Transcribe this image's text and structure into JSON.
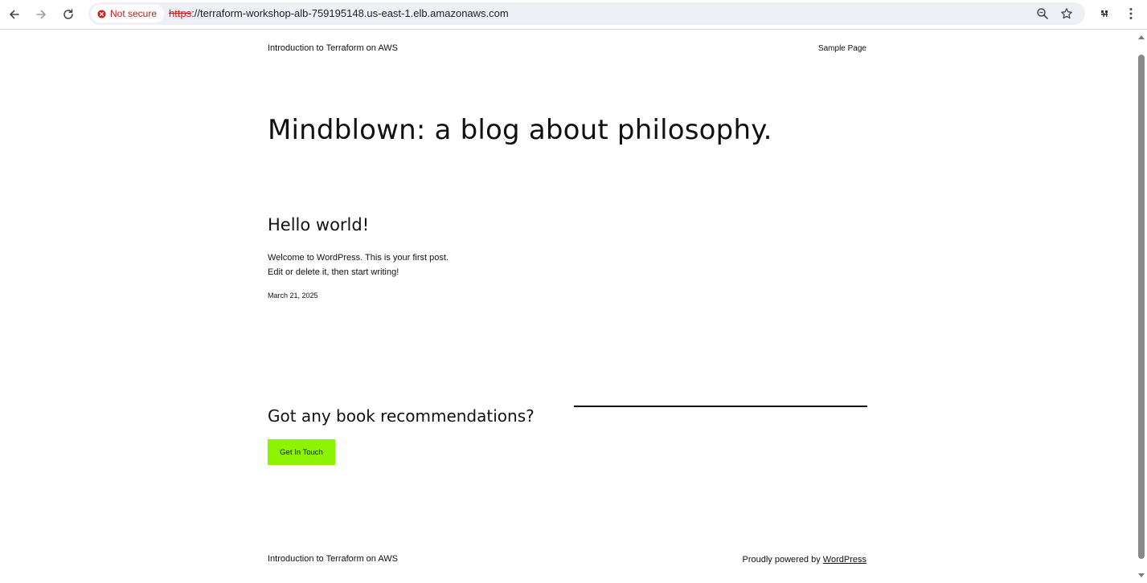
{
  "browser": {
    "security_chip": {
      "label": "Not secure",
      "color": "#b3261e"
    },
    "url": {
      "scheme": "https",
      "rest": "://terraform-workshop-alb-759195148.us-east-1.elb.amazonaws.com"
    },
    "icons": [
      "back-icon",
      "forward-icon",
      "reload-icon",
      "zoom-icon",
      "bookmark-star-icon",
      "extension-icon",
      "more-menu-icon"
    ]
  },
  "site": {
    "title": "Introduction to Terraform on AWS",
    "nav": {
      "sample_page": "Sample Page"
    }
  },
  "hero": {
    "heading": "Mindblown: a blog about philosophy."
  },
  "post": {
    "title": "Hello world!",
    "excerpt_line1": "Welcome to WordPress. This is your first post.",
    "excerpt_line2": "Edit or delete it, then start writing!",
    "date": "March 21, 2025"
  },
  "cta": {
    "heading": "Got any book recommendations?",
    "button_label": "Get In Touch",
    "button_color": "#8cf400"
  },
  "footer": {
    "site_title": "Introduction to Terraform on AWS",
    "credit_prefix": "Proudly powered by",
    "credit_link": "WordPress"
  }
}
